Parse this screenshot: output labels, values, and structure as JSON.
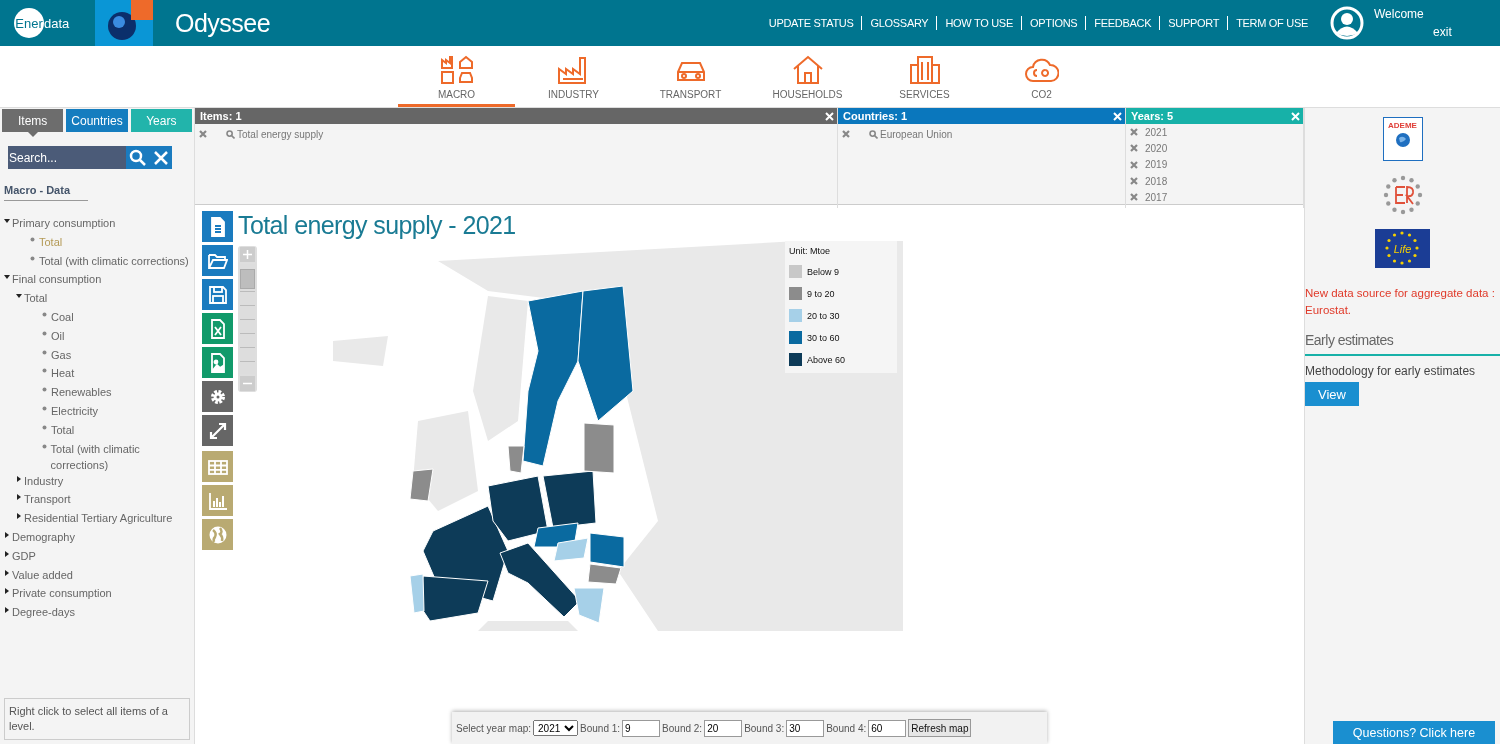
{
  "header": {
    "logo": {
      "circle_text": "Ener",
      "rest_text": "data"
    },
    "app_title": "Odyssee",
    "links": [
      "UPDATE STATUS",
      "GLOSSARY",
      "HOW TO USE",
      "OPTIONS",
      "FEEDBACK",
      "SUPPORT",
      "TERM OF USE"
    ],
    "user": {
      "greeting": "Welcome",
      "action": "exit"
    }
  },
  "categories": [
    {
      "label": "MACRO",
      "selected": true
    },
    {
      "label": "INDUSTRY",
      "selected": false
    },
    {
      "label": "TRANSPORT",
      "selected": false
    },
    {
      "label": "HOUSEHOLDS",
      "selected": false
    },
    {
      "label": "SERVICES",
      "selected": false
    },
    {
      "label": "CO2",
      "selected": false
    }
  ],
  "sidebar": {
    "tabs": [
      {
        "label": "Items",
        "selected": true,
        "color": "#666666"
      },
      {
        "label": "Countries",
        "selected": false,
        "color": "#0a77bd"
      },
      {
        "label": "Years",
        "selected": false,
        "color": "#17b1a8"
      }
    ],
    "search": {
      "placeholder": "Search..."
    },
    "section_title": "Macro - Data",
    "tree": [
      {
        "label": "Primary consumption",
        "kind": "group",
        "expanded": true,
        "selected": false,
        "children": [
          {
            "label": "Total",
            "kind": "leaf",
            "selected": true
          },
          {
            "label": "Total (with climatic corrections)",
            "kind": "leaf",
            "selected": false
          }
        ]
      },
      {
        "label": "Final consumption",
        "kind": "group",
        "expanded": true,
        "selected": false,
        "children": [
          {
            "label": "Total",
            "kind": "group",
            "expanded": true,
            "selected": false,
            "children": [
              {
                "label": "Coal",
                "kind": "leaf",
                "selected": false
              },
              {
                "label": "Oil",
                "kind": "leaf",
                "selected": false
              },
              {
                "label": "Gas",
                "kind": "leaf",
                "selected": false
              },
              {
                "label": "Heat",
                "kind": "leaf",
                "selected": false
              },
              {
                "label": "Renewables",
                "kind": "leaf",
                "selected": false
              },
              {
                "label": "Electricity",
                "kind": "leaf",
                "selected": false
              },
              {
                "label": "Total",
                "kind": "leaf",
                "selected": false
              },
              {
                "label": "Total (with climatic corrections)",
                "kind": "leaf",
                "selected": false
              }
            ]
          },
          {
            "label": "Industry",
            "kind": "group",
            "expanded": false,
            "selected": false
          },
          {
            "label": "Transport",
            "kind": "group",
            "expanded": false,
            "selected": false
          },
          {
            "label": "Residential Tertiary Agriculture",
            "kind": "group",
            "expanded": false,
            "selected": false
          }
        ]
      },
      {
        "label": "Demography",
        "kind": "group",
        "expanded": false,
        "selected": false
      },
      {
        "label": "GDP",
        "kind": "group",
        "expanded": false,
        "selected": false
      },
      {
        "label": "Value added",
        "kind": "group",
        "expanded": false,
        "selected": false
      },
      {
        "label": "Private consumption",
        "kind": "group",
        "expanded": false,
        "selected": false
      },
      {
        "label": "Degree-days",
        "kind": "group",
        "expanded": false,
        "selected": false
      }
    ],
    "hint": "Right click to select all items of a level."
  },
  "selection": [
    {
      "title": "Items: 1",
      "color": "#666666",
      "kind": "search",
      "entries": [
        "Total energy supply"
      ]
    },
    {
      "title": "Countries: 1",
      "color": "#0a77bd",
      "kind": "search",
      "entries": [
        "European Union"
      ]
    },
    {
      "title": "Years: 5",
      "color": "#17b1a8",
      "kind": "plain",
      "entries": [
        "2021",
        "2020",
        "2019",
        "2018",
        "2017"
      ]
    }
  ],
  "chart_title": "Total energy supply - 2021",
  "zoom": {
    "level": 0.95
  },
  "legend": {
    "unit": "Unit: Mtoe",
    "classes": [
      {
        "label": "Below 9",
        "color": "#c8c8c8"
      },
      {
        "label": "9 to 20",
        "color": "#8c8c8c"
      },
      {
        "label": "20 to 30",
        "color": "#a6d0e8"
      },
      {
        "label": "30 to 60",
        "color": "#0a6aa0"
      },
      {
        "label": "Above 60",
        "color": "#0d3b58"
      }
    ]
  },
  "map_controls": {
    "year_label": "Select year map:",
    "year": "2021",
    "bounds": [
      {
        "label": "Bound 1:",
        "value": "9"
      },
      {
        "label": "Bound 2:",
        "value": "20"
      },
      {
        "label": "Bound 3:",
        "value": "30"
      },
      {
        "label": "Bound 4:",
        "value": "60"
      }
    ],
    "button": "Refresh map"
  },
  "right_panel": {
    "logos": {
      "ademe": "ADEME",
      "life": "Life"
    },
    "notice": "New data source for aggregate data : Eurostat.",
    "section_title": "Early estimates",
    "text": "Methodology for early estimates",
    "button": "View"
  },
  "help_button": "Questions? Click here"
}
